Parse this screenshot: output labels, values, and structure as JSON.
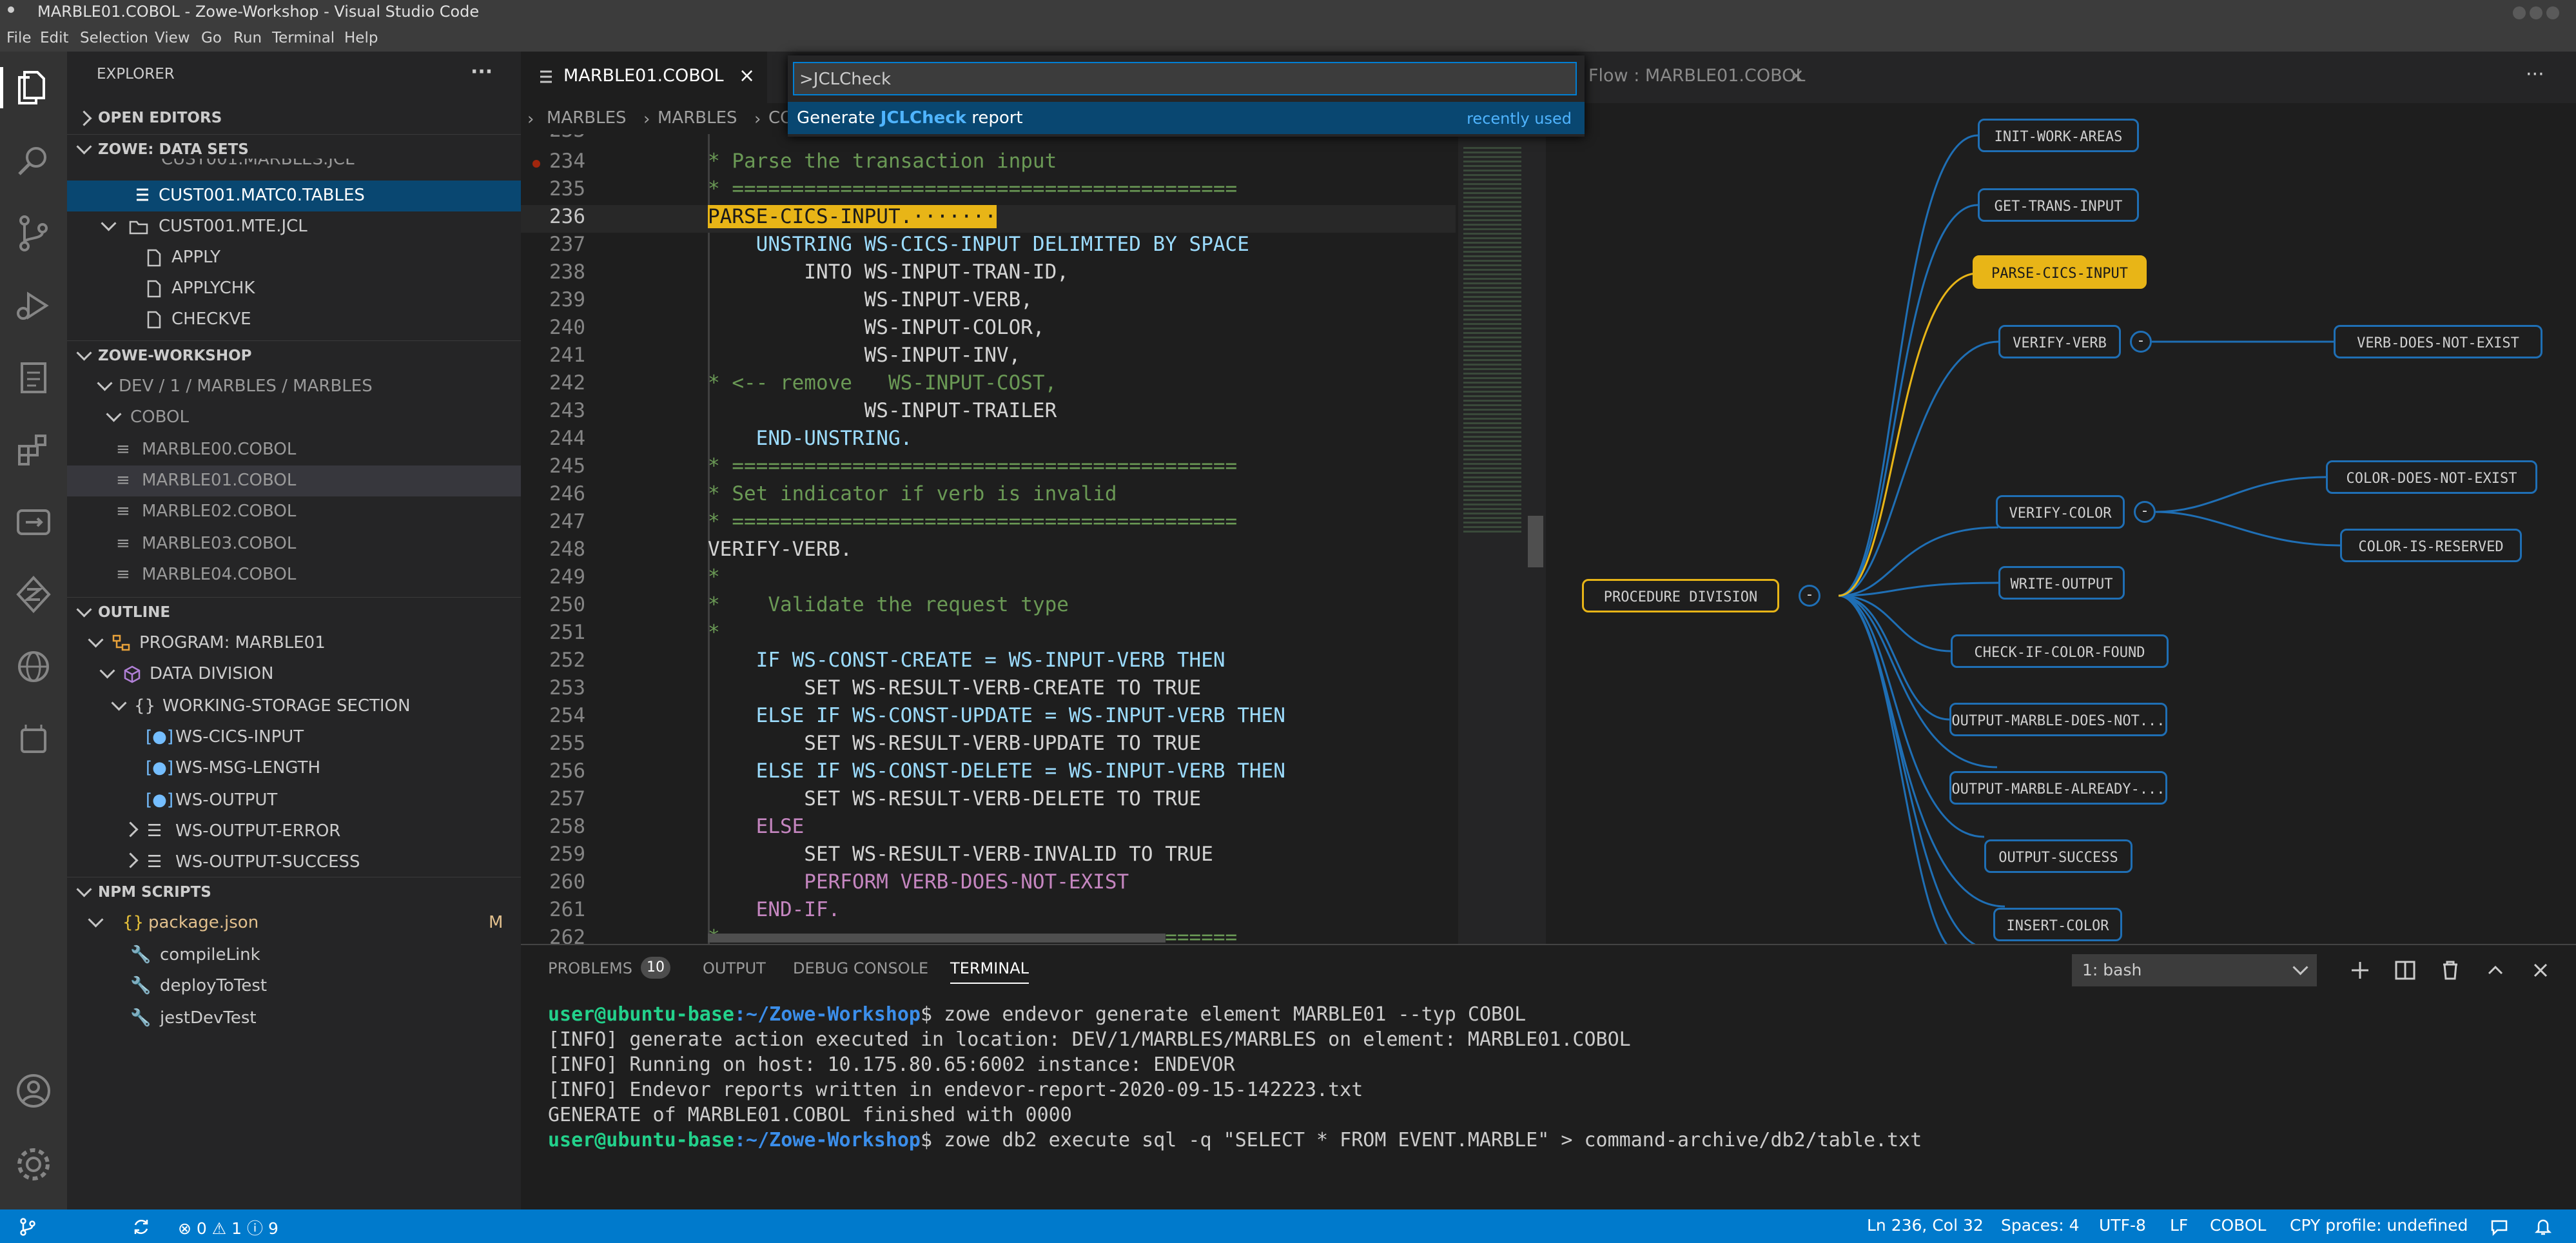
{
  "window": {
    "title": "MARBLE01.COBOL - Zowe-Workshop - Visual Studio Code"
  },
  "menu": [
    "File",
    "Edit",
    "Selection",
    "View",
    "Go",
    "Run",
    "Terminal",
    "Help"
  ],
  "sidebar": {
    "header": "EXPLORER",
    "sections": {
      "open_editors": "OPEN EDITORS",
      "data_sets": "ZOWE: DATA SETS",
      "workshop": "ZOWE-WORKSHOP",
      "outline": "OUTLINE",
      "npm": "NPM SCRIPTS"
    },
    "datasets": [
      "CUST001.MARBLES.JCL",
      "CUST001.MATC0.TABLES",
      "CUST001.MTE.JCL",
      "APPLY",
      "APPLYCHK",
      "CHECKVE"
    ],
    "workshop_items": [
      "DEV / 1 / MARBLES / MARBLES",
      "COBOL",
      "MARBLE00.COBOL",
      "MARBLE01.COBOL",
      "MARBLE02.COBOL",
      "MARBLE03.COBOL",
      "MARBLE04.COBOL"
    ],
    "outline_items": [
      "PROGRAM: MARBLE01",
      "DATA DIVISION",
      "WORKING-STORAGE SECTION",
      "WS-CICS-INPUT",
      "WS-MSG-LENGTH",
      "WS-OUTPUT",
      "WS-OUTPUT-ERROR",
      "WS-OUTPUT-SUCCESS"
    ],
    "npm_items": [
      "package.json",
      "compileLink",
      "deployToTest",
      "jestDevTest"
    ],
    "npm_badge": "M"
  },
  "tabs": {
    "active": "MARBLE01.COBOL",
    "flow": "Flow : MARBLE01.COBOL",
    "close": "×",
    "more": "···"
  },
  "breadcrumb": [
    "MARBLES",
    "MARBLES",
    "CO"
  ],
  "code": {
    "lines": [
      {
        "n": "233",
        "t": "* ========"
      },
      {
        "n": "234",
        "t": "* Parse the transaction input"
      },
      {
        "n": "235",
        "t": "* =========================================="
      },
      {
        "n": "236",
        "t": "PARSE-CICS-INPUT.·······"
      },
      {
        "n": "237",
        "t": "    UNSTRING WS-CICS-INPUT DELIMITED BY SPACE"
      },
      {
        "n": "238",
        "t": "        INTO WS-INPUT-TRAN-ID,"
      },
      {
        "n": "239",
        "t": "             WS-INPUT-VERB,"
      },
      {
        "n": "240",
        "t": "             WS-INPUT-COLOR,"
      },
      {
        "n": "241",
        "t": "             WS-INPUT-INV,"
      },
      {
        "n": "242",
        "t": "* <-- remove   WS-INPUT-COST,"
      },
      {
        "n": "243",
        "t": "             WS-INPUT-TRAILER"
      },
      {
        "n": "244",
        "t": "    END-UNSTRING."
      },
      {
        "n": "245",
        "t": "* =========================================="
      },
      {
        "n": "246",
        "t": "* Set indicator if verb is invalid"
      },
      {
        "n": "247",
        "t": "* =========================================="
      },
      {
        "n": "248",
        "t": "VERIFY-VERB."
      },
      {
        "n": "249",
        "t": "*"
      },
      {
        "n": "250",
        "t": "*    Validate the request type"
      },
      {
        "n": "251",
        "t": "*"
      },
      {
        "n": "252",
        "t": "    IF WS-CONST-CREATE = WS-INPUT-VERB THEN"
      },
      {
        "n": "253",
        "t": "        SET WS-RESULT-VERB-CREATE TO TRUE"
      },
      {
        "n": "254",
        "t": "    ELSE IF WS-CONST-UPDATE = WS-INPUT-VERB THEN"
      },
      {
        "n": "255",
        "t": "        SET WS-RESULT-VERB-UPDATE TO TRUE"
      },
      {
        "n": "256",
        "t": "    ELSE IF WS-CONST-DELETE = WS-INPUT-VERB THEN"
      },
      {
        "n": "257",
        "t": "        SET WS-RESULT-VERB-DELETE TO TRUE"
      },
      {
        "n": "258",
        "t": "    ELSE"
      },
      {
        "n": "259",
        "t": "        SET WS-RESULT-VERB-INVALID TO TRUE"
      },
      {
        "n": "260",
        "t": "        PERFORM VERB-DOES-NOT-EXIST"
      },
      {
        "n": "261",
        "t": "    END-IF."
      },
      {
        "n": "262",
        "t": "* =========================================="
      }
    ]
  },
  "palette": {
    "input_value": ">JCLCheck",
    "item_prefix": "Generate",
    "item_highlight": "JCLCheck",
    "item_suffix": "report",
    "item_hint": "recently used"
  },
  "flow": {
    "root": "PROCEDURE DIVISION",
    "collapse_glyph": "-",
    "nodes": [
      "INIT-WORK-AREAS",
      "GET-TRANS-INPUT",
      "PARSE-CICS-INPUT",
      "VERIFY-VERB",
      "VERIFY-COLOR",
      "WRITE-OUTPUT",
      "CHECK-IF-COLOR-FOUND",
      "OUTPUT-MARBLE-DOES-NOT...",
      "OUTPUT-MARBLE-ALREADY-...",
      "OUTPUT-SUCCESS",
      "INSERT-COLOR"
    ],
    "leaf_nodes": [
      "VERB-DOES-NOT-EXIST",
      "COLOR-DOES-NOT-EXIST",
      "COLOR-IS-RESERVED"
    ]
  },
  "panel": {
    "tabs": [
      "PROBLEMS",
      "OUTPUT",
      "DEBUG CONSOLE",
      "TERMINAL"
    ],
    "problems_count": "10",
    "terminal_select": "1: bash",
    "prompt_user": "user@ubuntu-base",
    "prompt_path": ":~/Zowe-Workshop",
    "cmd1": "$ zowe endevor generate element MARBLE01 --typ COBOL",
    "out1": "[INFO] generate action executed in location: DEV/1/MARBLES/MARBLES on element: MARBLE01.COBOL",
    "out2": "[INFO] Running on host: 10.175.80.65:6002 instance: ENDEVOR",
    "out3": "[INFO] Endevor reports written in endevor-report-2020-09-15-142223.txt",
    "out4": "GENERATE of MARBLE01.COBOL finished with 0000",
    "cmd2": "$ zowe db2 execute sql -q \"SELECT * FROM EVENT.MARBLE\" > command-archive/db2/table.txt"
  },
  "status": {
    "errors": "0",
    "warnings": "1",
    "infos": "9",
    "position": "Ln 236, Col 32",
    "spaces": "Spaces: 4",
    "encoding": "UTF-8",
    "eol": "LF",
    "language": "COBOL",
    "profile": "CPY profile: undefined"
  },
  "colors": {
    "accent": "#007acc",
    "highlight": "#e8b517",
    "flow_link": "#1f6fb5"
  }
}
